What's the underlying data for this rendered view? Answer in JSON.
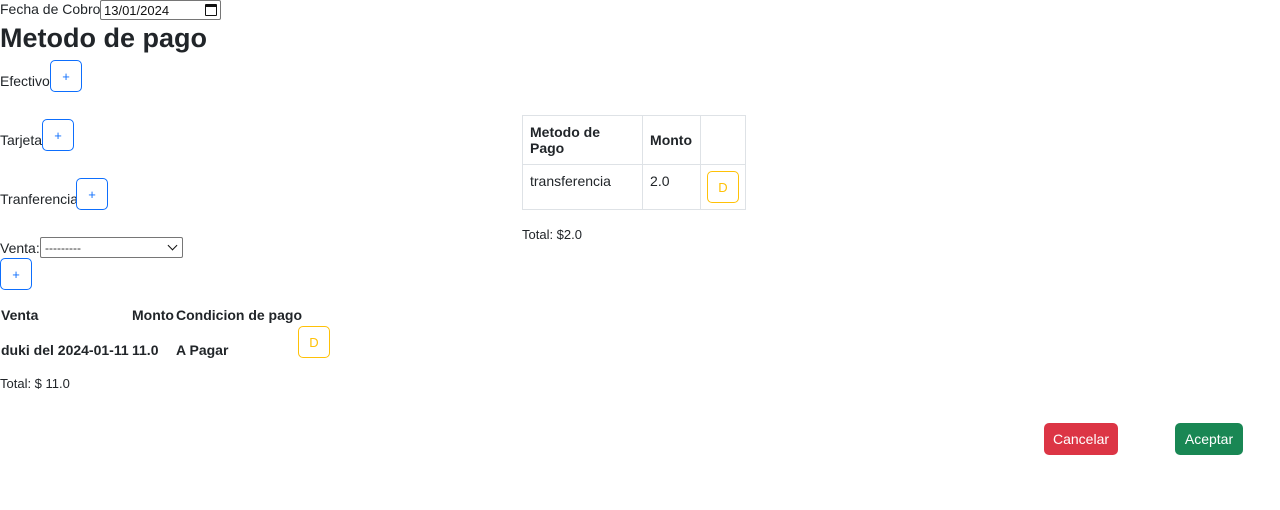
{
  "header": {
    "date_label": "Fecha de Cobro:",
    "date_value": "13/01/2024",
    "title": "Metodo de pago"
  },
  "methods": [
    {
      "label": "Efectivo",
      "button": "+"
    },
    {
      "label": "Tarjeta",
      "button": "+"
    },
    {
      "label": "Tranferencia",
      "button": "+"
    }
  ],
  "venta_selector": {
    "label": "Venta:",
    "selected": "---------",
    "add_button": "+"
  },
  "ventas_table": {
    "headers": [
      "Venta",
      "Monto",
      "Condicion de pago"
    ],
    "rows": [
      {
        "venta": "duki del 2024-01-11",
        "monto": "11.0",
        "condicion": "A Pagar",
        "action": "D"
      }
    ],
    "total": "Total: $ 11.0"
  },
  "pagos_table": {
    "headers": [
      "Metodo de Pago",
      "Monto",
      ""
    ],
    "rows": [
      {
        "metodo": "transferencia",
        "monto": "2.0",
        "action": "D"
      }
    ],
    "total": "Total: $2.0"
  },
  "footer": {
    "cancel_label": "Cancelar",
    "accept_label": "Aceptar"
  },
  "colors": {
    "primary": "#0d6efd",
    "warning": "#ffc107",
    "danger": "#dc3545",
    "success": "#198754"
  }
}
